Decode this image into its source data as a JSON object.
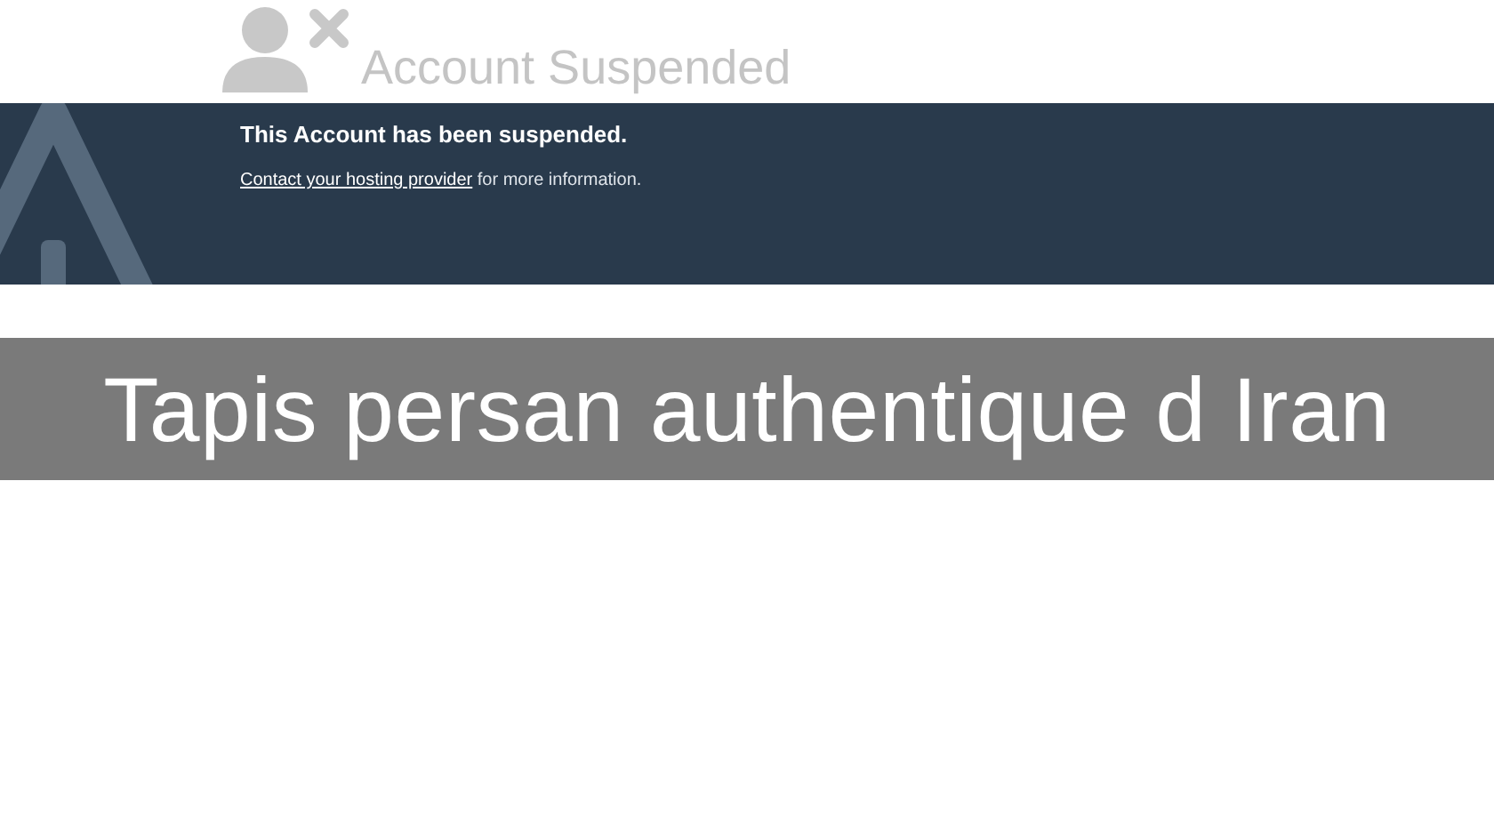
{
  "header": {
    "title": "Account Suspended"
  },
  "notice": {
    "heading": "This Account has been suspended.",
    "link": "Contact your hosting provider",
    "text": " for more information."
  },
  "caption": {
    "title": "Tapis persan authentique d Iran"
  }
}
